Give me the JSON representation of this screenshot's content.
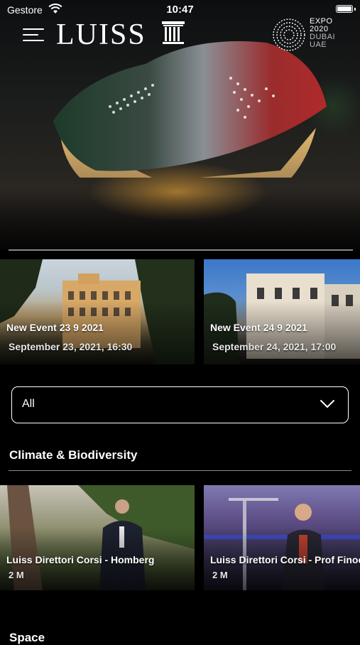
{
  "status_bar": {
    "carrier": "Gestore",
    "time": "10:47"
  },
  "header": {
    "logo": "LUISS",
    "expo_lines": [
      "EXPO",
      "2020",
      "DUBAI",
      "UAE"
    ]
  },
  "events": [
    {
      "title": "New Event 23 9 2021",
      "date": "September 23, 2021, 16:30"
    },
    {
      "title": "New Event 24 9 2021",
      "date": "September 24, 2021, 17:00"
    }
  ],
  "filter": {
    "selected": "All"
  },
  "sections": [
    {
      "title": "Climate & Biodiversity",
      "videos": [
        {
          "title": "Luiss Direttori Corsi - Homberg",
          "meta": "2 M"
        },
        {
          "title": "Luiss Direttori Corsi - Prof Finocc",
          "meta": "2 M"
        }
      ]
    },
    {
      "title": "Space"
    }
  ],
  "colors": {
    "background": "#000000",
    "text": "#ffffff",
    "divider": "#8a8a8a"
  }
}
